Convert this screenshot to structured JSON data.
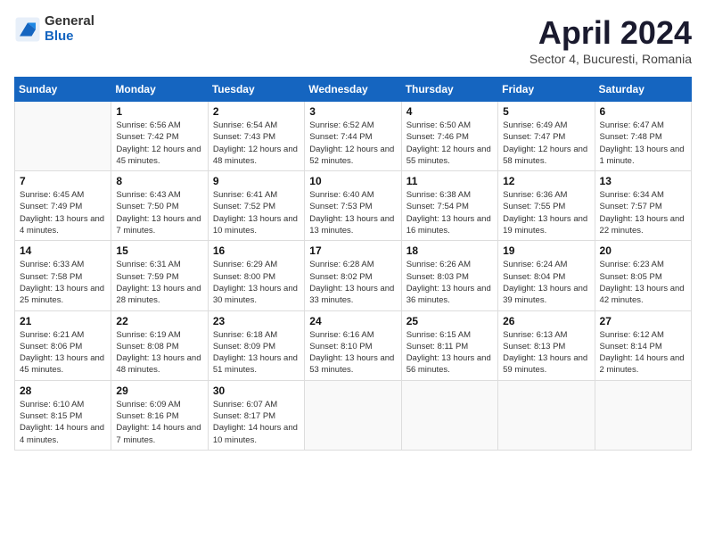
{
  "header": {
    "logo_general": "General",
    "logo_blue": "Blue",
    "month_title": "April 2024",
    "subtitle": "Sector 4, Bucuresti, Romania"
  },
  "weekdays": [
    "Sunday",
    "Monday",
    "Tuesday",
    "Wednesday",
    "Thursday",
    "Friday",
    "Saturday"
  ],
  "weeks": [
    [
      {
        "day": "",
        "empty": true
      },
      {
        "day": "1",
        "sunrise": "Sunrise: 6:56 AM",
        "sunset": "Sunset: 7:42 PM",
        "daylight": "Daylight: 12 hours and 45 minutes."
      },
      {
        "day": "2",
        "sunrise": "Sunrise: 6:54 AM",
        "sunset": "Sunset: 7:43 PM",
        "daylight": "Daylight: 12 hours and 48 minutes."
      },
      {
        "day": "3",
        "sunrise": "Sunrise: 6:52 AM",
        "sunset": "Sunset: 7:44 PM",
        "daylight": "Daylight: 12 hours and 52 minutes."
      },
      {
        "day": "4",
        "sunrise": "Sunrise: 6:50 AM",
        "sunset": "Sunset: 7:46 PM",
        "daylight": "Daylight: 12 hours and 55 minutes."
      },
      {
        "day": "5",
        "sunrise": "Sunrise: 6:49 AM",
        "sunset": "Sunset: 7:47 PM",
        "daylight": "Daylight: 12 hours and 58 minutes."
      },
      {
        "day": "6",
        "sunrise": "Sunrise: 6:47 AM",
        "sunset": "Sunset: 7:48 PM",
        "daylight": "Daylight: 13 hours and 1 minute."
      }
    ],
    [
      {
        "day": "7",
        "sunrise": "Sunrise: 6:45 AM",
        "sunset": "Sunset: 7:49 PM",
        "daylight": "Daylight: 13 hours and 4 minutes."
      },
      {
        "day": "8",
        "sunrise": "Sunrise: 6:43 AM",
        "sunset": "Sunset: 7:50 PM",
        "daylight": "Daylight: 13 hours and 7 minutes."
      },
      {
        "day": "9",
        "sunrise": "Sunrise: 6:41 AM",
        "sunset": "Sunset: 7:52 PM",
        "daylight": "Daylight: 13 hours and 10 minutes."
      },
      {
        "day": "10",
        "sunrise": "Sunrise: 6:40 AM",
        "sunset": "Sunset: 7:53 PM",
        "daylight": "Daylight: 13 hours and 13 minutes."
      },
      {
        "day": "11",
        "sunrise": "Sunrise: 6:38 AM",
        "sunset": "Sunset: 7:54 PM",
        "daylight": "Daylight: 13 hours and 16 minutes."
      },
      {
        "day": "12",
        "sunrise": "Sunrise: 6:36 AM",
        "sunset": "Sunset: 7:55 PM",
        "daylight": "Daylight: 13 hours and 19 minutes."
      },
      {
        "day": "13",
        "sunrise": "Sunrise: 6:34 AM",
        "sunset": "Sunset: 7:57 PM",
        "daylight": "Daylight: 13 hours and 22 minutes."
      }
    ],
    [
      {
        "day": "14",
        "sunrise": "Sunrise: 6:33 AM",
        "sunset": "Sunset: 7:58 PM",
        "daylight": "Daylight: 13 hours and 25 minutes."
      },
      {
        "day": "15",
        "sunrise": "Sunrise: 6:31 AM",
        "sunset": "Sunset: 7:59 PM",
        "daylight": "Daylight: 13 hours and 28 minutes."
      },
      {
        "day": "16",
        "sunrise": "Sunrise: 6:29 AM",
        "sunset": "Sunset: 8:00 PM",
        "daylight": "Daylight: 13 hours and 30 minutes."
      },
      {
        "day": "17",
        "sunrise": "Sunrise: 6:28 AM",
        "sunset": "Sunset: 8:02 PM",
        "daylight": "Daylight: 13 hours and 33 minutes."
      },
      {
        "day": "18",
        "sunrise": "Sunrise: 6:26 AM",
        "sunset": "Sunset: 8:03 PM",
        "daylight": "Daylight: 13 hours and 36 minutes."
      },
      {
        "day": "19",
        "sunrise": "Sunrise: 6:24 AM",
        "sunset": "Sunset: 8:04 PM",
        "daylight": "Daylight: 13 hours and 39 minutes."
      },
      {
        "day": "20",
        "sunrise": "Sunrise: 6:23 AM",
        "sunset": "Sunset: 8:05 PM",
        "daylight": "Daylight: 13 hours and 42 minutes."
      }
    ],
    [
      {
        "day": "21",
        "sunrise": "Sunrise: 6:21 AM",
        "sunset": "Sunset: 8:06 PM",
        "daylight": "Daylight: 13 hours and 45 minutes."
      },
      {
        "day": "22",
        "sunrise": "Sunrise: 6:19 AM",
        "sunset": "Sunset: 8:08 PM",
        "daylight": "Daylight: 13 hours and 48 minutes."
      },
      {
        "day": "23",
        "sunrise": "Sunrise: 6:18 AM",
        "sunset": "Sunset: 8:09 PM",
        "daylight": "Daylight: 13 hours and 51 minutes."
      },
      {
        "day": "24",
        "sunrise": "Sunrise: 6:16 AM",
        "sunset": "Sunset: 8:10 PM",
        "daylight": "Daylight: 13 hours and 53 minutes."
      },
      {
        "day": "25",
        "sunrise": "Sunrise: 6:15 AM",
        "sunset": "Sunset: 8:11 PM",
        "daylight": "Daylight: 13 hours and 56 minutes."
      },
      {
        "day": "26",
        "sunrise": "Sunrise: 6:13 AM",
        "sunset": "Sunset: 8:13 PM",
        "daylight": "Daylight: 13 hours and 59 minutes."
      },
      {
        "day": "27",
        "sunrise": "Sunrise: 6:12 AM",
        "sunset": "Sunset: 8:14 PM",
        "daylight": "Daylight: 14 hours and 2 minutes."
      }
    ],
    [
      {
        "day": "28",
        "sunrise": "Sunrise: 6:10 AM",
        "sunset": "Sunset: 8:15 PM",
        "daylight": "Daylight: 14 hours and 4 minutes."
      },
      {
        "day": "29",
        "sunrise": "Sunrise: 6:09 AM",
        "sunset": "Sunset: 8:16 PM",
        "daylight": "Daylight: 14 hours and 7 minutes."
      },
      {
        "day": "30",
        "sunrise": "Sunrise: 6:07 AM",
        "sunset": "Sunset: 8:17 PM",
        "daylight": "Daylight: 14 hours and 10 minutes."
      },
      {
        "day": "",
        "empty": true
      },
      {
        "day": "",
        "empty": true
      },
      {
        "day": "",
        "empty": true
      },
      {
        "day": "",
        "empty": true
      }
    ]
  ]
}
